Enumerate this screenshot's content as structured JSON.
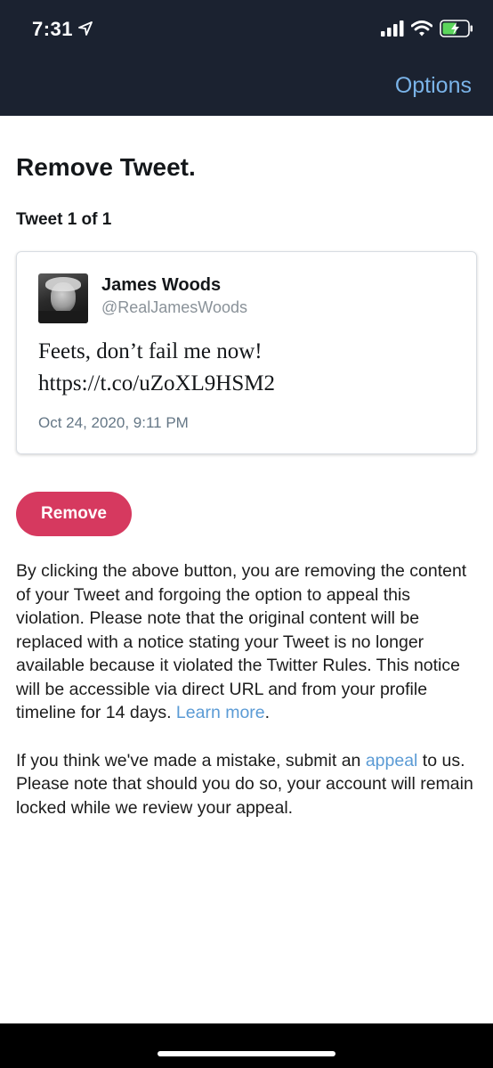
{
  "status_bar": {
    "time": "7:31",
    "location_icon": "location-arrow-icon",
    "signal_icon": "cellular-signal-icon",
    "wifi_icon": "wifi-icon",
    "battery_icon": "battery-charging-icon",
    "battery_color": "#5cd65c"
  },
  "nav": {
    "options_label": "Options",
    "accent_color": "#7ab3e8"
  },
  "page": {
    "title": "Remove Tweet.",
    "tweet_counter": "Tweet 1 of 1"
  },
  "tweet": {
    "author_name": "James Woods",
    "author_handle": "@RealJamesWoods",
    "text_line1": "Feets, don’t fail me now!",
    "text_line2": "https://t.co/uZoXL9HSM2",
    "timestamp": "Oct 24, 2020, 9:11 PM"
  },
  "remove_button": {
    "label": "Remove",
    "color": "#d6395f"
  },
  "notice": {
    "paragraph1_text": "By clicking the above button, you are removing the content of your Tweet and forgoing the option to appeal this violation. Please note that the original content will be replaced with a notice stating your Tweet is no longer available because it violated the Twitter Rules. This notice will be accessible via direct URL and from your profile timeline for 14 days. ",
    "learn_more_label": "Learn more",
    "paragraph1_end": ".",
    "paragraph2_start": "If you think we've made a mistake, submit an ",
    "appeal_label": "appeal",
    "paragraph2_end": " to us. Please note that should you do so, your account will remain locked while we review your appeal.",
    "link_color": "#5b9bd5"
  }
}
